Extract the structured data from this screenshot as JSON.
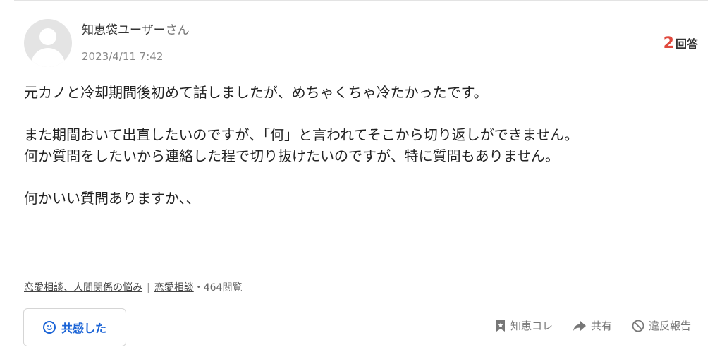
{
  "question": {
    "user_name": "知恵袋ユーザー",
    "user_suffix": "さん",
    "date": "2023/4/11 7:42",
    "answer_count": "2",
    "answer_label": "回答",
    "paragraphs": [
      "元カノと冷却期間後初めて話しましたが、めちゃくちゃ冷たかったです。",
      "",
      "また期間おいて出直したいのですが、「何」と言われてそこから切り返しができません。",
      "何か質問をしたいから連絡した程で切り抜けたいのですが、特に質問もありません。",
      "",
      "何かいい質問ありますか、、"
    ],
    "category_primary": "恋愛相談、人間関係の悩み",
    "category_separator": "|",
    "category_secondary": "恋愛相談",
    "views": "・464閲覧"
  },
  "actions": {
    "empathy_label": "共感した",
    "chiebox_label": "知恵コレ",
    "share_label": "共有",
    "report_label": "違反報告"
  },
  "colors": {
    "accent_blue": "#1a63d6",
    "answer_red": "#e0493d"
  },
  "icons": {
    "avatar": "default-user-avatar",
    "empathy": "smile-icon",
    "chiebox": "bookmark-icon",
    "share": "share-arrow-icon",
    "report": "prohibited-icon"
  }
}
